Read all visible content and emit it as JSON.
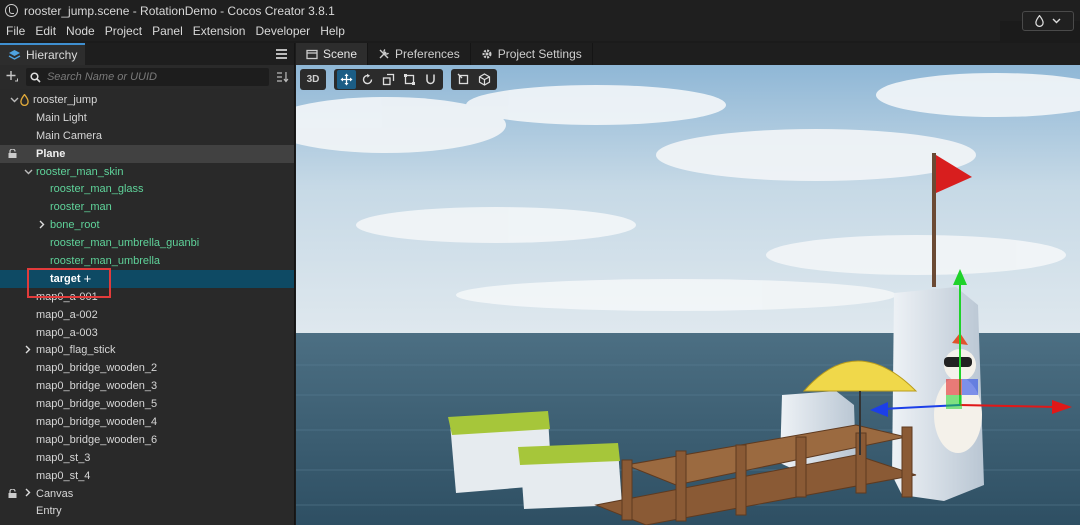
{
  "window": {
    "title": "rooster_jump.scene - RotationDemo - Cocos Creator 3.8.1"
  },
  "menu": [
    "File",
    "Edit",
    "Node",
    "Project",
    "Panel",
    "Extension",
    "Developer",
    "Help"
  ],
  "hierarchy": {
    "tab_label": "Hierarchy",
    "search_placeholder": "Search Name or UUID",
    "nodes": [
      {
        "label": "rooster_jump",
        "indent": 0,
        "arrow": "down",
        "icon": "scene-icon"
      },
      {
        "label": "Main Light",
        "indent": 1
      },
      {
        "label": "Main Camera",
        "indent": 1
      },
      {
        "label": "Plane",
        "indent": 1,
        "state": "hover",
        "lock": true
      },
      {
        "label": "rooster_man_skin",
        "indent": 1,
        "arrow": "down",
        "prefab": true
      },
      {
        "label": "rooster_man_glass",
        "indent": 2,
        "prefab": true
      },
      {
        "label": "rooster_man",
        "indent": 2,
        "prefab": true
      },
      {
        "label": "bone_root",
        "indent": 2,
        "arrow": "right",
        "prefab": true
      },
      {
        "label": "rooster_man_umbrella_guanbi",
        "indent": 2,
        "prefab": true
      },
      {
        "label": "rooster_man_umbrella",
        "indent": 2,
        "prefab": true
      },
      {
        "label": "target",
        "indent": 2,
        "state": "selected"
      },
      {
        "label": "map0_a-001",
        "indent": 1
      },
      {
        "label": "map0_a-002",
        "indent": 1
      },
      {
        "label": "map0_a-003",
        "indent": 1
      },
      {
        "label": "map0_flag_stick",
        "indent": 1,
        "arrow": "right"
      },
      {
        "label": "map0_bridge_wooden_2",
        "indent": 1
      },
      {
        "label": "map0_bridge_wooden_3",
        "indent": 1
      },
      {
        "label": "map0_bridge_wooden_5",
        "indent": 1
      },
      {
        "label": "map0_bridge_wooden_4",
        "indent": 1
      },
      {
        "label": "map0_bridge_wooden_6",
        "indent": 1
      },
      {
        "label": "map0_st_3",
        "indent": 1
      },
      {
        "label": "map0_st_4",
        "indent": 1
      },
      {
        "label": "Canvas",
        "indent": 1,
        "arrow": "right",
        "lock": true
      },
      {
        "label": "Entry",
        "indent": 1
      }
    ]
  },
  "scene_tabs": [
    {
      "label": "Scene",
      "icon": "scene-tab-icon",
      "active": true
    },
    {
      "label": "Preferences",
      "icon": "tools-icon"
    },
    {
      "label": "Project Settings",
      "icon": "gear-icon"
    }
  ],
  "viewport_toolbar": {
    "mode_3d": "3D"
  },
  "colors": {
    "selection": "#0e4a64",
    "prefab_text": "#5fd39a",
    "accent": "#1b5d85",
    "highlight_box": "#e23b3b"
  }
}
